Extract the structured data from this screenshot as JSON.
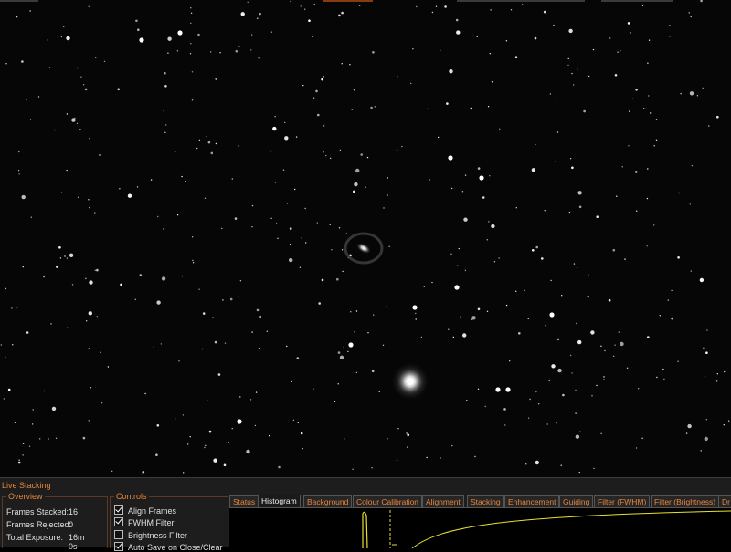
{
  "panel": {
    "title": "Live Stacking",
    "overview": {
      "label": "Overview",
      "rows": [
        {
          "name": "Frames Stacked:",
          "value": "16"
        },
        {
          "name": "Frames Rejected:",
          "value": "0"
        },
        {
          "name": "Total Exposure:",
          "value": "16m 0s"
        }
      ]
    },
    "controls": {
      "label": "Controls",
      "items": [
        {
          "label": "Align Frames",
          "checked": true
        },
        {
          "label": "FWHM Filter",
          "checked": true
        },
        {
          "label": "Brightness Filter",
          "checked": false
        },
        {
          "label": "Auto Save on Close/Clear",
          "checked": true
        }
      ]
    },
    "tabs": [
      "Status",
      "Histogram",
      "Background",
      "Colour Calibration",
      "Alignment",
      "Stacking",
      "Enhancement",
      "Guiding",
      "Filter (FWHM)",
      "Filter (Brightness)",
      "Dr"
    ],
    "active_tab": "Histogram"
  },
  "colors": {
    "accent": "#e8843a",
    "histogram_curve": "#e8e030",
    "background": "#1d1d1d"
  }
}
